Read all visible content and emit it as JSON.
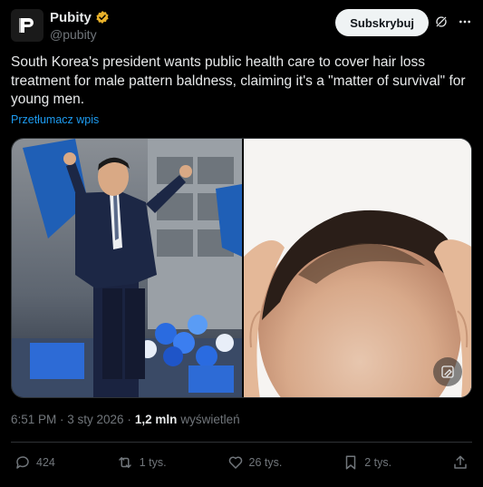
{
  "post": {
    "display_name": "Pubity",
    "handle": "@pubity",
    "subscribe_label": "Subskrybuj",
    "text": "South Korea's president wants public health care to cover hair loss treatment for male pattern baldness, claiming it's a \"matter of survival\" for young men.",
    "translate_label": "Przetłumacz wpis",
    "timestamp": "6:51 PM · 3 sty 2026 ·",
    "views_count": "1,2 mln",
    "views_label": "wyświetleń"
  },
  "actions": {
    "replies": "424",
    "reposts": "1 tys.",
    "likes": "26 tys.",
    "bookmarks": "2 tys."
  },
  "colors": {
    "background": "#000000",
    "text": "#e7e9ea",
    "muted": "#71767b",
    "link": "#1d9bf0",
    "verified": "#e8b12a",
    "button_bg": "#eff3f4"
  },
  "icons": {
    "avatar": "pubity-logo-icon",
    "verified": "verified-badge-icon",
    "grok": "grok-icon",
    "more": "more-icon",
    "reply": "reply-icon",
    "repost": "repost-icon",
    "like": "heart-icon",
    "bookmark": "bookmark-icon",
    "share": "share-icon",
    "alt": "image-edit-icon"
  }
}
